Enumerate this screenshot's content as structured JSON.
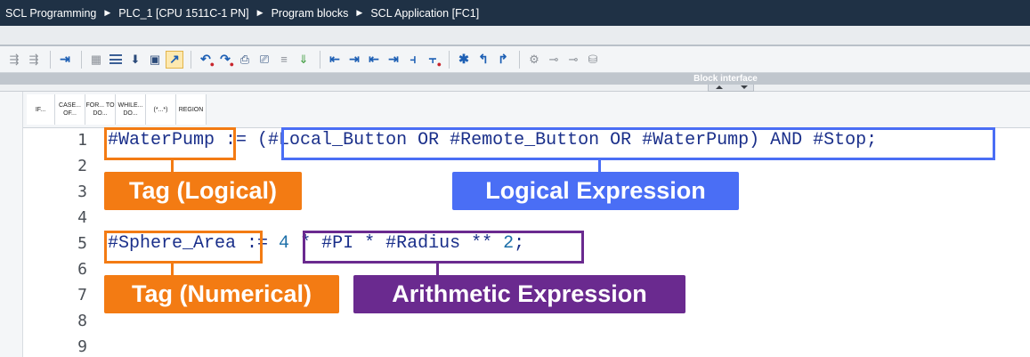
{
  "breadcrumb": [
    "SCL Programming",
    "PLC_1 [CPU 1511C-1 PN]",
    "Program blocks",
    "SCL Application [FC1]"
  ],
  "toolbar": {
    "icons": [
      "indent-icon",
      "outdent-icon",
      "insert-icon",
      "network-icon",
      "list-icon",
      "download-icon",
      "module-icon",
      "call-icon",
      "favorites-icon",
      "monitor-icon",
      "delete-icon",
      "go-to-icon",
      "go-back-icon",
      "jump-icon",
      "bookmark-icon",
      "next-bookmark-icon",
      "prev-bookmark-icon",
      "clear-bookmark-icon",
      "comment-icon",
      "uncomment-icon",
      "indent-more-icon",
      "indent-less-icon",
      "collapse-icon",
      "expand-icon",
      "breakpoint-icon",
      "step-over-icon",
      "step-into-icon",
      "monitoring-icon",
      "compare-icon",
      "snapshot-icon"
    ]
  },
  "block_interface": {
    "label": "Block interface"
  },
  "templates": [
    {
      "label": "IF..."
    },
    {
      "label": "CASE... OF..."
    },
    {
      "label": "FOR... TO DO..."
    },
    {
      "label": "WHILE... DO..."
    },
    {
      "label": "(*...*)"
    },
    {
      "label": "REGION"
    }
  ],
  "editor": {
    "line_numbers": [
      "1",
      "2",
      "3",
      "4",
      "5",
      "6",
      "7",
      "8",
      "9"
    ],
    "line1": {
      "tag": "#WaterPump",
      "assign": " := ",
      "expr": "(#Local_Button OR #Remote_Button OR #WaterPump) AND #Stop",
      "end": ";"
    },
    "line5": {
      "tag": "#Sphere_Area",
      "assign": " := ",
      "expr_num1": "4",
      "expr_mid": " * #PI * #Radius ** ",
      "expr_num2": "2",
      "end": ";"
    }
  },
  "annotations": {
    "tag_logical": "Tag (Logical)",
    "logical_expression": "Logical Expression",
    "tag_numerical": "Tag (Numerical)",
    "arithmetic_expression": "Arithmetic Expression"
  },
  "colors": {
    "orange": "#f37b13",
    "blue": "#4a6ef5",
    "purple": "#6a2a8f",
    "code_text": "#1a2f8a",
    "title_bar": "#1f3145"
  }
}
